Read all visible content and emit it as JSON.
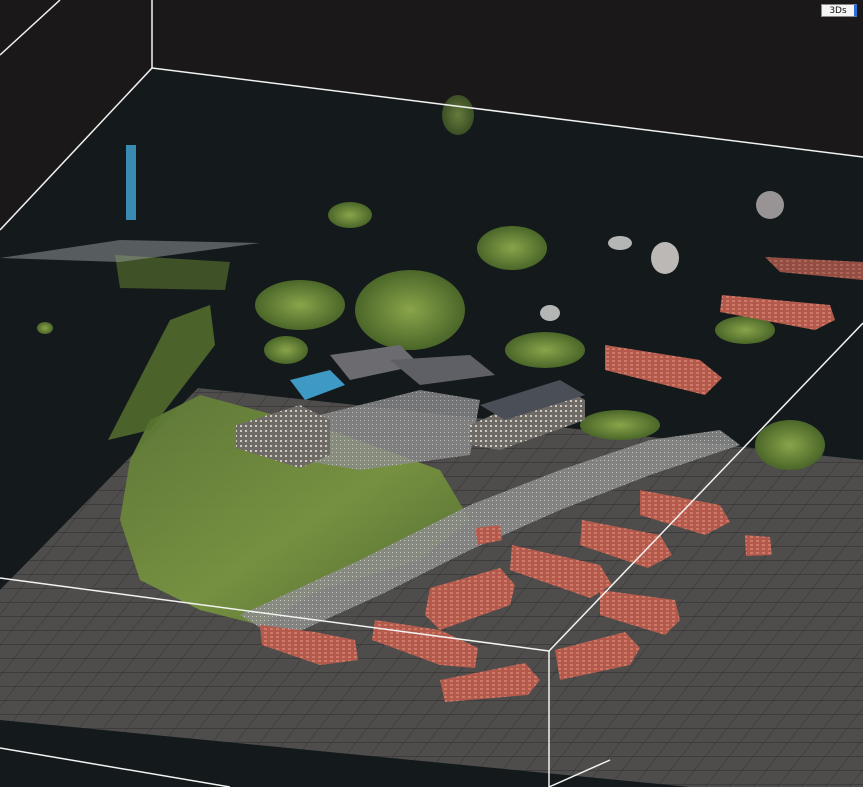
{
  "viewer": {
    "mode_label": "3Ds",
    "background_color": "#1b181a",
    "colors": {
      "bounding_box": "#f2f2f2",
      "grid_fill": "#4e4d4c",
      "grid_line": "#2f2e2d",
      "vegetation": "#6f8f3a",
      "roof": "#b85a4c",
      "pavement": "#a9a9a9",
      "highlight": "#43a7d8"
    }
  }
}
